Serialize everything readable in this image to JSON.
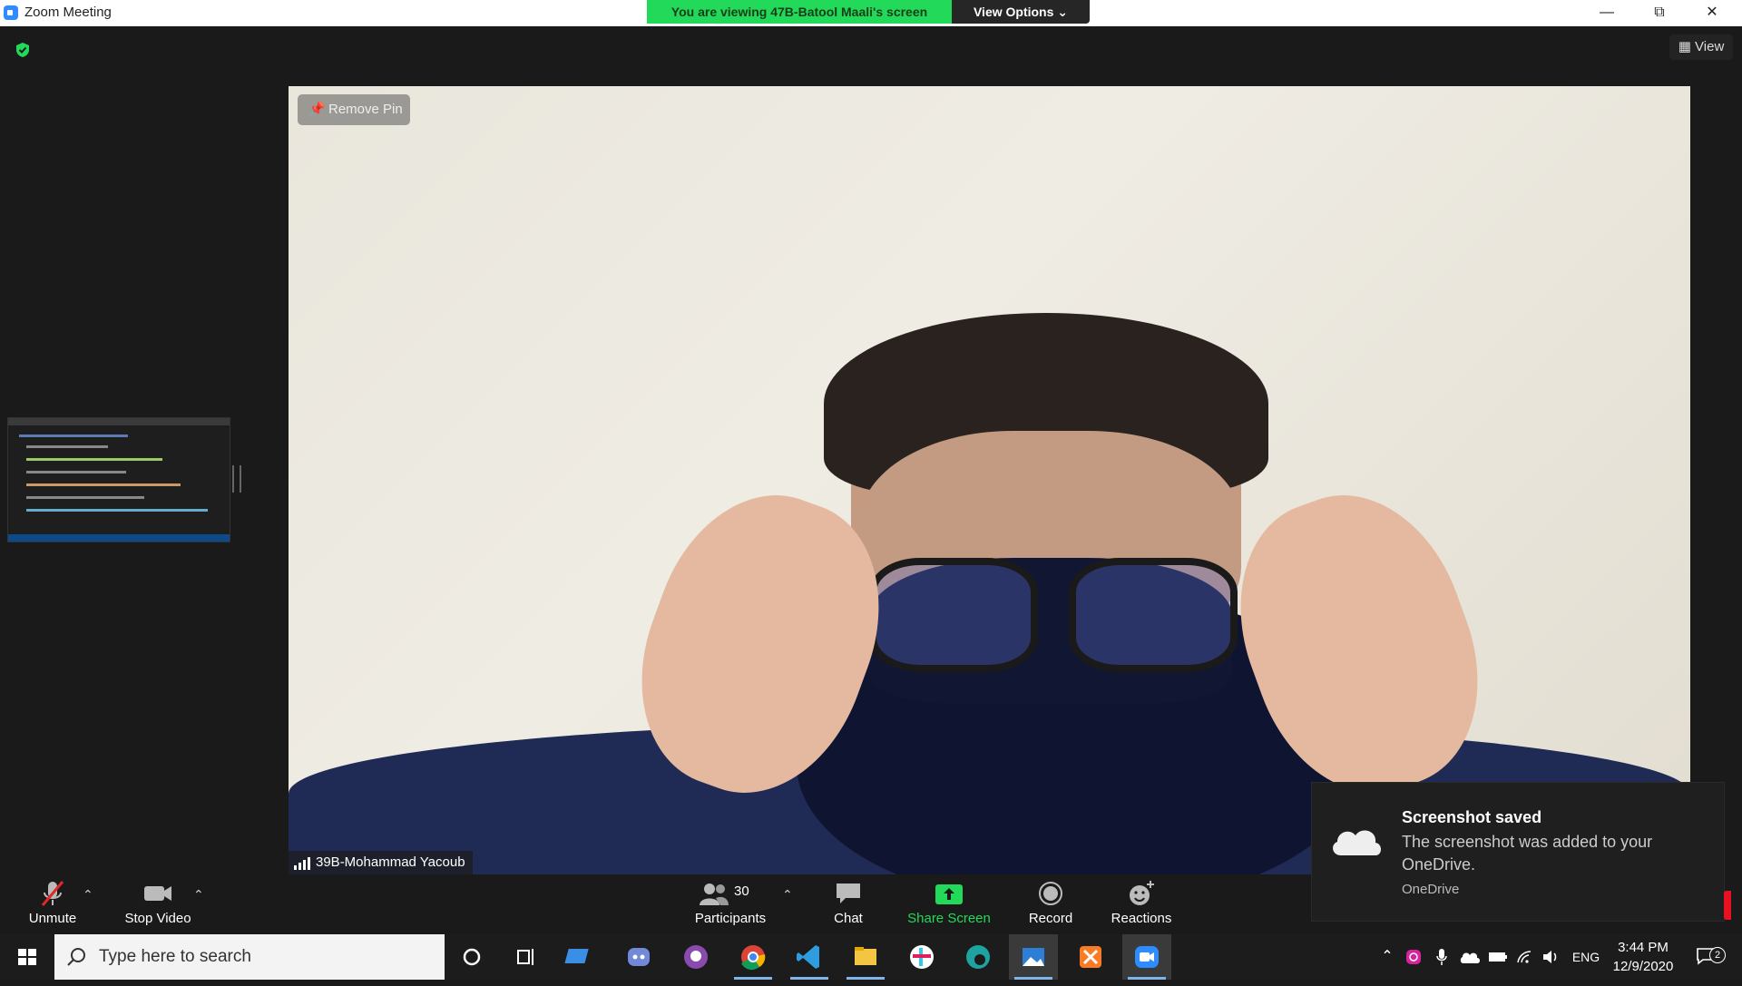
{
  "window": {
    "title": "Zoom Meeting",
    "controls": [
      "minimize",
      "restore",
      "close"
    ]
  },
  "share_banner": {
    "text": "You are viewing 47B-Batool Maali's screen",
    "view_options": "View Options"
  },
  "top_bar": {
    "view_label": "View"
  },
  "main_video": {
    "remove_pin": "Remove Pin",
    "participant_name": "39B-Mohammad Yacoub"
  },
  "toolbar": {
    "unmute": "Unmute",
    "stop_video": "Stop Video",
    "participants": "Participants",
    "participants_count": "30",
    "chat": "Chat",
    "share_screen": "Share Screen",
    "record": "Record",
    "reactions": "Reactions"
  },
  "toast": {
    "title": "Screenshot saved",
    "message": "The screenshot was added to your OneDrive.",
    "source": "OneDrive"
  },
  "taskbar": {
    "search_placeholder": "Type here to search",
    "apps": [
      "cortana-icon",
      "task-view-icon",
      "onedrive-app-icon",
      "discord-icon",
      "github-desktop-icon",
      "chrome-icon",
      "vscode-icon",
      "file-explorer-icon",
      "slack-icon",
      "edge-icon",
      "photos-icon",
      "xampp-icon",
      "zoom-icon"
    ],
    "language": "ENG",
    "time": "3:44 PM",
    "date": "12/9/2020",
    "notification_count": "2"
  },
  "colors": {
    "share_green": "#23d959",
    "zoom_blue": "#2d8cff",
    "taskbar": "#1c1c1c"
  }
}
